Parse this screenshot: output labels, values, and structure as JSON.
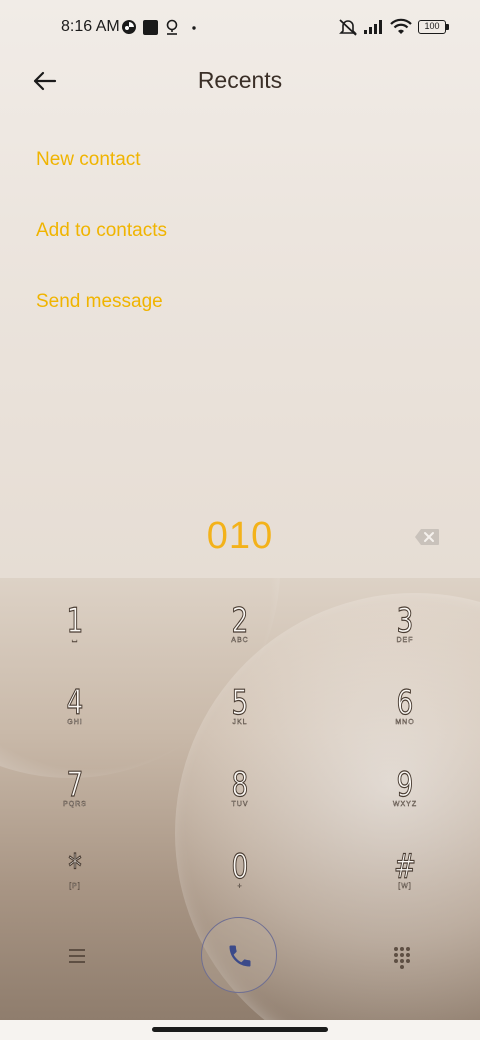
{
  "status_bar": {
    "time": "8:16 AM",
    "battery": "100"
  },
  "header": {
    "title": "Recents"
  },
  "actions": [
    "New contact",
    "Add to contacts",
    "Send message"
  ],
  "dialed_number": "010",
  "keypad": [
    {
      "digit": "1",
      "letters": ""
    },
    {
      "digit": "2",
      "letters": "ABC"
    },
    {
      "digit": "3",
      "letters": "DEF"
    },
    {
      "digit": "4",
      "letters": "GHI"
    },
    {
      "digit": "5",
      "letters": "JKL"
    },
    {
      "digit": "6",
      "letters": "MNO"
    },
    {
      "digit": "7",
      "letters": "PQRS"
    },
    {
      "digit": "8",
      "letters": "TUV"
    },
    {
      "digit": "9",
      "letters": "WXYZ"
    },
    {
      "digit": "*",
      "letters": "[P]"
    },
    {
      "digit": "0",
      "letters": "+"
    },
    {
      "digit": "#",
      "letters": "[W]"
    }
  ],
  "colors": {
    "accent": "#f0b400",
    "number": "#f3b21a",
    "call_ring": "#6f6f92",
    "call_icon": "#3b4a8a"
  },
  "icons": [
    "back-arrow-icon",
    "backspace-icon",
    "menu-icon",
    "phone-icon",
    "dialpad-icon",
    "voicemail-icon",
    "silent-icon",
    "signal-icon",
    "wifi-icon",
    "battery-icon",
    "location-icon"
  ]
}
